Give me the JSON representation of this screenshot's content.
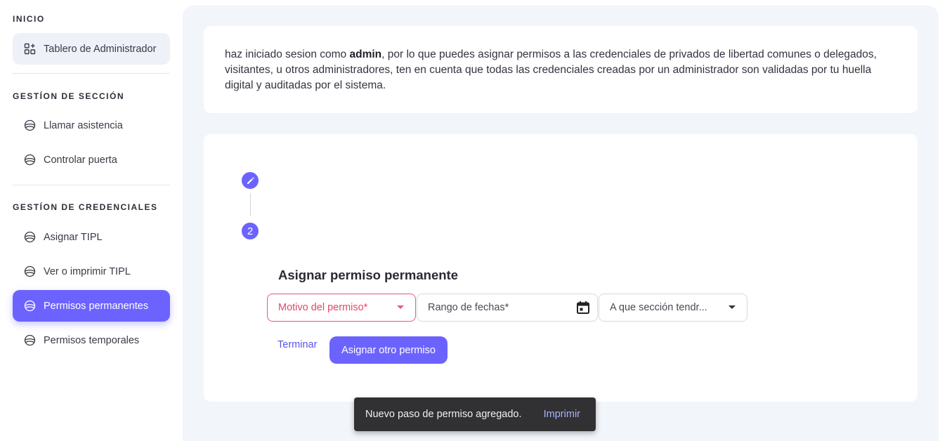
{
  "sidebar": {
    "sections": [
      {
        "title": "INICIO"
      },
      {
        "title": "GESTÍON DE SECCIÓN"
      },
      {
        "title": "GESTÍON DE CREDENCIALES"
      }
    ],
    "items": [
      {
        "label": "Tablero de Administrador",
        "icon": "dashboard-icon"
      },
      {
        "label": "Llamar asistencia",
        "icon": "globe-icon"
      },
      {
        "label": "Controlar puerta",
        "icon": "globe-icon"
      },
      {
        "label": "Asignar TIPL",
        "icon": "globe-icon"
      },
      {
        "label": "Ver o imprimir TIPL",
        "icon": "globe-icon"
      },
      {
        "label": "Permisos permanentes",
        "icon": "globe-icon",
        "active": true
      },
      {
        "label": "Permisos temporales",
        "icon": "globe-icon"
      }
    ]
  },
  "info": {
    "prefix": "haz iniciado sesion como ",
    "user": "admin",
    "suffix": ", por lo que puedes asignar permisos a las credenciales de privados de libertad comunes o delegados, visitantes, u otros administradores, ten en cuenta que todas las credenciales creadas por un administrador son validadas por tu huella digital y auditadas por el sistema."
  },
  "stepper": {
    "step1_icon": "pencil-icon",
    "step2_label": "2"
  },
  "form": {
    "title": "Asignar permiso permanente",
    "motivo_placeholder": "Motivo del permiso*",
    "rango_placeholder": "Rango de fechas*",
    "seccion_placeholder": "A que sección tendr...",
    "finish_label": "Terminar",
    "another_label": "Asignar otro permiso"
  },
  "snackbar": {
    "message": "Nuevo paso de permiso agregado.",
    "action": "Imprimir"
  },
  "colors": {
    "accent": "#6c63ff",
    "error": "#e8597a",
    "background": "#f2f5fa"
  }
}
